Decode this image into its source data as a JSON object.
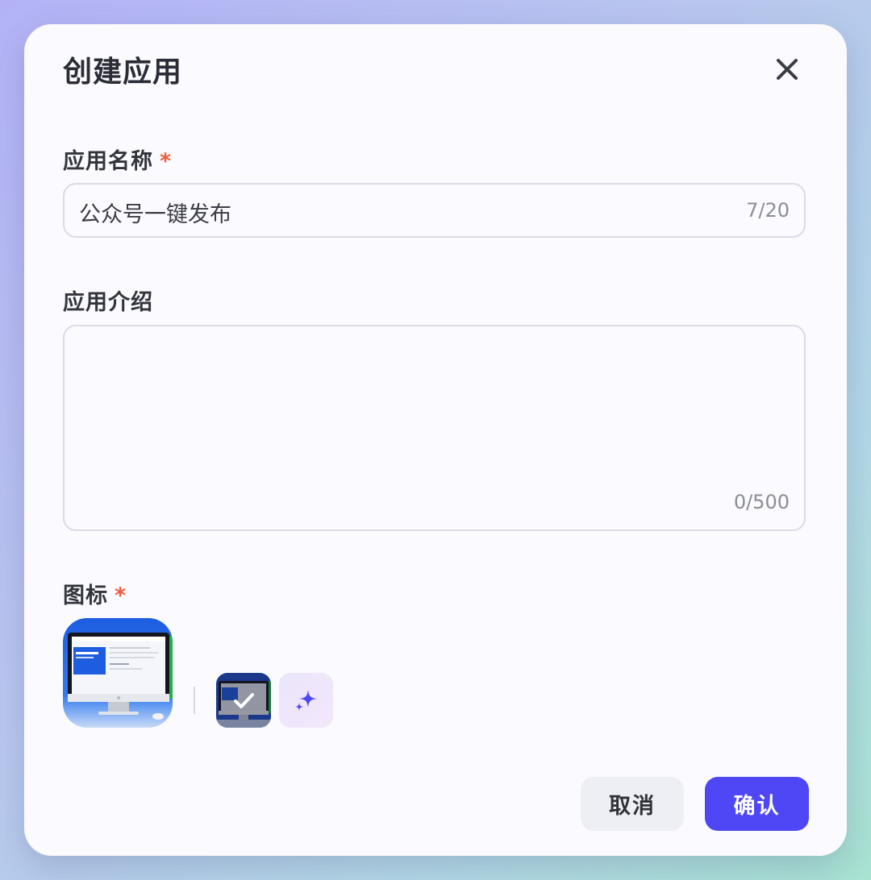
{
  "dialog": {
    "title": "创建应用",
    "close_icon": "close-icon"
  },
  "form": {
    "name": {
      "label": "应用名称",
      "required_mark": "*",
      "value": "公众号一键发布",
      "counter": "7/20"
    },
    "intro": {
      "label": "应用介绍",
      "value": "",
      "counter": "0/500"
    },
    "icon": {
      "label": "图标",
      "required_mark": "*",
      "selected_icon": "imac-screen-icon",
      "ai_generate_icon": "sparkle-icon"
    }
  },
  "footer": {
    "cancel_label": "取消",
    "confirm_label": "确认"
  },
  "colors": {
    "accent": "#4f47f5",
    "required": "#f05a3a",
    "border": "#dcdbe6"
  }
}
